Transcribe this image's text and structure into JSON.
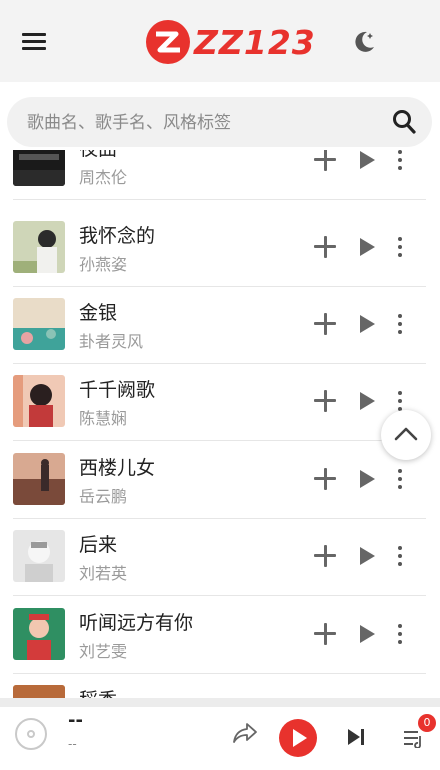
{
  "colors": {
    "accent": "#e8322d",
    "header_bg": "#f3f3f3",
    "search_bg": "#f1f1f1"
  },
  "header": {
    "logo_text": "ZZ123",
    "menu_icon": "hamburger-icon",
    "theme_icon": "moon-icon"
  },
  "search": {
    "placeholder": "歌曲名、歌手名、风格标签",
    "value": "",
    "icon": "search-icon"
  },
  "songs": [
    {
      "title": "夜曲",
      "artist": "周杰伦"
    },
    {
      "title": "我怀念的",
      "artist": "孙燕姿"
    },
    {
      "title": "金银",
      "artist": "卦者灵风"
    },
    {
      "title": "千千阙歌",
      "artist": "陈慧娴"
    },
    {
      "title": "西楼儿女",
      "artist": "岳云鹏"
    },
    {
      "title": "后来",
      "artist": "刘若英"
    },
    {
      "title": "听闻远方有你",
      "artist": "刘艺雯"
    },
    {
      "title": "稻香",
      "artist": ""
    }
  ],
  "player": {
    "title": "--",
    "artist": "--",
    "queue_count": "0"
  }
}
